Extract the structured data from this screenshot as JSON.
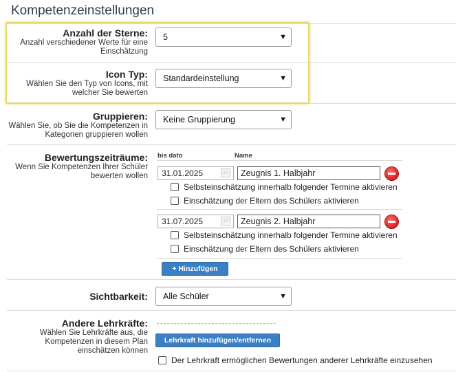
{
  "page_title": "Kompetenzeinstellungen",
  "stars": {
    "title": "Anzahl der Sterne:",
    "description": "Anzahl verschiedener Werte für eine Einschätzung",
    "value": "5"
  },
  "icon_type": {
    "title": "Icon Typ:",
    "description": "Wählen Sie den Typ von Icons, mit welcher Sie bewerten",
    "value": "Standardeinstellung"
  },
  "grouping": {
    "title": "Gruppieren:",
    "description": "Wählen Sie, ob Sie die Kompetenzen in Kategorien gruppieren wollen",
    "value": "Keine Gruppierung"
  },
  "periods": {
    "title": "Bewertungszeiträume:",
    "description": "Wenn Sie Kompetenzen Ihrer Schüler bewerten wollen",
    "col_date": "bis dato",
    "col_name": "Name",
    "items": [
      {
        "date": "31.01.2025",
        "name": "Zeugnis 1. Halbjahr",
        "self_assessment": "Selbsteinschätzung innerhalb folgender Termine aktivieren",
        "parents_assessment": "Einschätzung der Eltern des Schülers aktivieren"
      },
      {
        "date": "31.07.2025",
        "name": "Zeugnis 2. Halbjahr",
        "self_assessment": "Selbsteinschätzung innerhalb folgender Termine aktivieren",
        "parents_assessment": "Einschätzung der Eltern des Schülers aktivieren"
      }
    ],
    "add_label": "+ Hinzufügen"
  },
  "visibility": {
    "title": "Sichtbarkeit:",
    "value": "Alle Schüler"
  },
  "other_teachers": {
    "title": "Andere Lehrkräfte:",
    "description": "Wählen Sie Lehrkräfte aus, die Kompetenzen in diesem Plan einschätzen können",
    "button_label": "Lehrkraft hinzufügen/entfernen",
    "checkbox_label": "Der Lehrkraft ermöglichen Bewertungen anderer Lehrkräfte einzusehen"
  },
  "colors": {
    "highlight": "#e5d96a",
    "button": "#3b7fc4",
    "delete": "#d40000"
  }
}
